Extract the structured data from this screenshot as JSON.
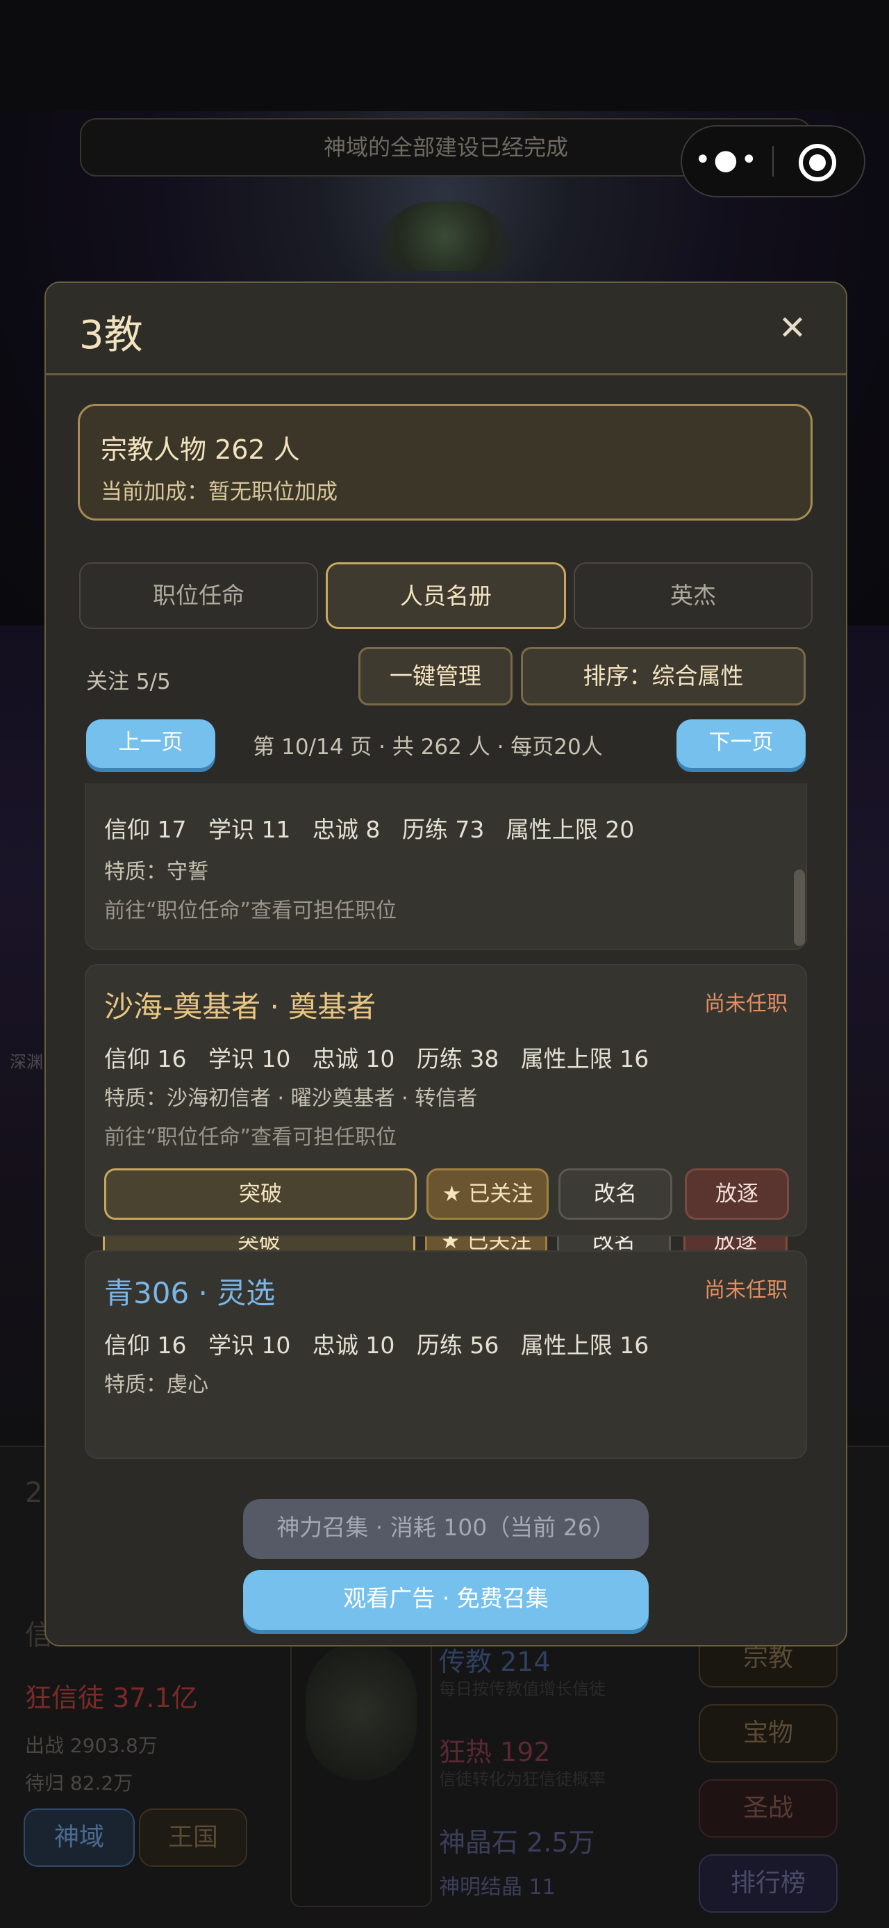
{
  "background": {
    "notice": "神域的全部建设已经完成",
    "fanatic": "狂信徒 37.1亿",
    "sub_line_1": "出战 2903.8万",
    "sub_line_2": "待归 82.2万",
    "left_faded": "信",
    "left_num": "2",
    "side_label": "深渊",
    "bottom_tabs": [
      "神域",
      "王国"
    ],
    "right_buttons": [
      "宗教",
      "宝物",
      "圣战",
      "排行榜"
    ],
    "center_stats": [
      {
        "label": "传教 214",
        "desc": "每日按传教值增长信徒"
      },
      {
        "label": "狂热 192",
        "desc": "信徒转化为狂信徒概率"
      },
      {
        "label": "神晶石 2.5万",
        "desc": ""
      },
      {
        "label": "神明结晶 11",
        "desc": ""
      }
    ]
  },
  "modal": {
    "title": "3教",
    "close_icon": "close-icon",
    "summary": {
      "count": "宗教人物 262 人",
      "bonus": "当前加成：暂无职位加成"
    },
    "tabs": [
      "职位任命",
      "人员名册",
      "英杰"
    ],
    "active_tab": "人员名册",
    "follow": "关注 5/5",
    "manage_button": "一键管理",
    "sort_button": "排序：综合属性",
    "pager": {
      "prev": "上一页",
      "next": "下一页",
      "info": "第 10/14 页 · 共 262 人 · 每页20人"
    },
    "cards": [
      {
        "name": "",
        "status": "",
        "stats": "信仰 17   学识 11   忠诚 8   历练 73   属性上限 20",
        "trait": "特质：守誓",
        "hint": "前往“职位任命”查看可担任职位",
        "buttons": [
          "突破",
          "★ 已关注",
          "改名",
          "放逐"
        ]
      },
      {
        "name": "沙海-奠基者 · 奠基者",
        "status": "尚未任职",
        "stats": "信仰 16   学识 10   忠诚 10   历练 38   属性上限 16",
        "trait": "特质：沙海初信者 · 曜沙奠基者 · 转信者",
        "hint": "前往“职位任命”查看可担任职位",
        "buttons": [
          "突破",
          "★ 已关注",
          "改名",
          "放逐"
        ]
      },
      {
        "name": "青306 · 灵选",
        "status": "尚未任职",
        "stats": "信仰 16   学识 10   忠诚 10   历练 56   属性上限 16",
        "trait": "特质：虔心",
        "hint": "",
        "buttons": []
      }
    ],
    "summon_divine": "神力召集 · 消耗 100（当前 26）",
    "summon_ad": "观看广告 · 免费召集"
  },
  "colors": {
    "gold_accent": "#c9a85e",
    "blue_button": "#76c0ee",
    "status_orange": "#e08f62",
    "name_gold": "#e8c682",
    "name_blue": "#7ab6e8"
  }
}
